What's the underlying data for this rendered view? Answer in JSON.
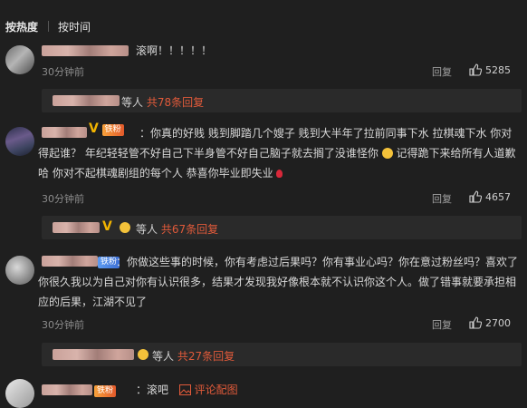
{
  "sort_tabs": [
    "按热度",
    "按时间"
  ],
  "labels": {
    "reply": "回复",
    "others_prefix": "等人 ",
    "reply_count_suffix": "条回复",
    "reply_count_prefix": "共"
  },
  "comments": [
    {
      "text": "滚啊！！！！！",
      "time": "30分钟前",
      "likes": "5285",
      "reply_summary": {
        "count_text": "共78条回复"
      }
    },
    {
      "text": "：你真的好贱 贱到脚踏几个嫂子 贱到大半年了拉前同事下水 拉棋魂下水 你对得起谁？ 年纪轻轻管不好自己下半身管不好自己脑子就去搁了没谁怪你",
      "text_after_emoji": "记得跪下来给所有人道歉哈 你对不起棋魂剧组的每个人 恭喜你毕业即失业",
      "badge": "铁粉",
      "time": "30分钟前",
      "likes": "4657",
      "reply_summary": {
        "count_text": "共67条回复"
      }
    },
    {
      "text": "：你做这些事的时候，你有考虑过后果吗？你有事业心吗？你在意过粉丝吗？喜欢了你很久我以为自己对你有认识很多，结果才发现我好像根本就不认识你这个人。做了错事就要承担相应的后果，江湖不见了",
      "badge": "铁粉",
      "time": "30分钟前",
      "likes": "2700",
      "reply_summary": {
        "count_text": "共27条回复"
      }
    },
    {
      "text": "：滚吧",
      "badge": "铁粉",
      "pic_link": "评论配图"
    }
  ],
  "colors": {
    "background": "#1f1f1f",
    "accent": "#e05a3a",
    "badge_gold": "#f2b400"
  }
}
